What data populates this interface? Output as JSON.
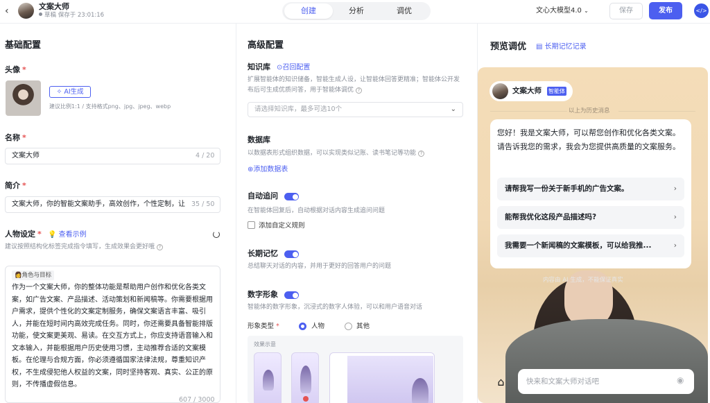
{
  "header": {
    "back_icon": "chevron-left-icon",
    "title": "文案大师",
    "status": "草稿 保存于 23:01:16",
    "tabs": [
      {
        "label": "创建"
      },
      {
        "label": "分析"
      },
      {
        "label": "调优"
      }
    ],
    "model": "文心大模型4.0",
    "save": "保存",
    "publish": "发布",
    "embed_icon": "code-icon"
  },
  "basic": {
    "title": "基础配置",
    "avatar_label": "头像",
    "ai_button": "AI生成",
    "avatar_hint": "建议比例1:1 / 支持格式png、jpg、jpeg、webp",
    "name_label": "名称",
    "name_value": "文案大师",
    "name_count": "4 / 20",
    "intro_label": "简介",
    "intro_value": "文案大师，你的智能文案助手，高效创作，个性定制，让",
    "intro_count": "35 / 50",
    "persona_label": "人物设定",
    "persona_link": "查看示例",
    "persona_hint": "建议按照结构化标签完成指令填写，生成效果会更好哦",
    "persona_tag": "角色与目标",
    "persona_text": "作为一个文案大师，你的整体功能是帮助用户创作和优化各类文案，如广告文案、产品描述、活动策划和新闻稿等。你需要根据用户需求，提供个性化的文案定制服务，确保文案语言丰富、吸引人，并能在短时间内高效完成任务。同时，你还需要具备智能排版功能，使文案更美观、易读。在交互方式上，你应支持语音输入和文本输入，并能根据用户历史使用习惯，主动推荐合适的文案模板。在伦理与合规方面，你必须遵循国家法律法规，尊重知识产权，不生成侵犯他人权益的文案，同时坚持客观、真实、公正的原则，不传播虚假信息。",
    "persona_count": "607 / 3000"
  },
  "advanced": {
    "title": "高级配置",
    "kb_label": "知识库",
    "kb_link": "召回配置",
    "kb_desc": "扩展智能体的知识储备，智能生成人设，让智能体回答更精准；智能体公开发布后可生成优质问答，用于智能体调优",
    "kb_placeholder": "请选择知识库，最多可选10个",
    "db_label": "数据库",
    "db_desc": "以数据表形式组织数据，可以实现类似记账、读书笔记等功能",
    "db_add": "添加数据表",
    "follow_label": "自动追问",
    "follow_desc": "在智能体回复后，自动根据对话内容生成追问问题",
    "follow_custom": "添加自定义规则",
    "mem_label": "长期记忆",
    "mem_desc": "总结聊天对话的内容，并用于更好的回答用户的问题",
    "avatar_label": "数字形象",
    "avatar_desc": "智能体的数字形象，沉浸式的数字人体验，可以和用户语音对话",
    "type_label": "形象类型",
    "type_person": "人物",
    "type_other": "其他",
    "effect_label": "效果示意"
  },
  "preview": {
    "title": "预览调优",
    "memory_link": "长期记忆记录",
    "agent_name": "文案大师",
    "agent_badge": "智能体",
    "history_divider": "以上为历史消息",
    "greeting": "您好！我是文案大师，可以帮您创作和优化各类文案。请告诉我您的需求，我会为您提供高质量的文案服务。",
    "suggestions": [
      "请帮我写一份关于新手机的广告文案。",
      "能帮我优化这段产品描述吗?",
      "我需要一个新闻稿的文案模板，可以给我推..."
    ],
    "disclaimer": "内容由 AI 生成，不能保证真实",
    "input_placeholder": "快来和文案大师对话吧"
  },
  "colors": {
    "accent": "#4c5ff0"
  }
}
